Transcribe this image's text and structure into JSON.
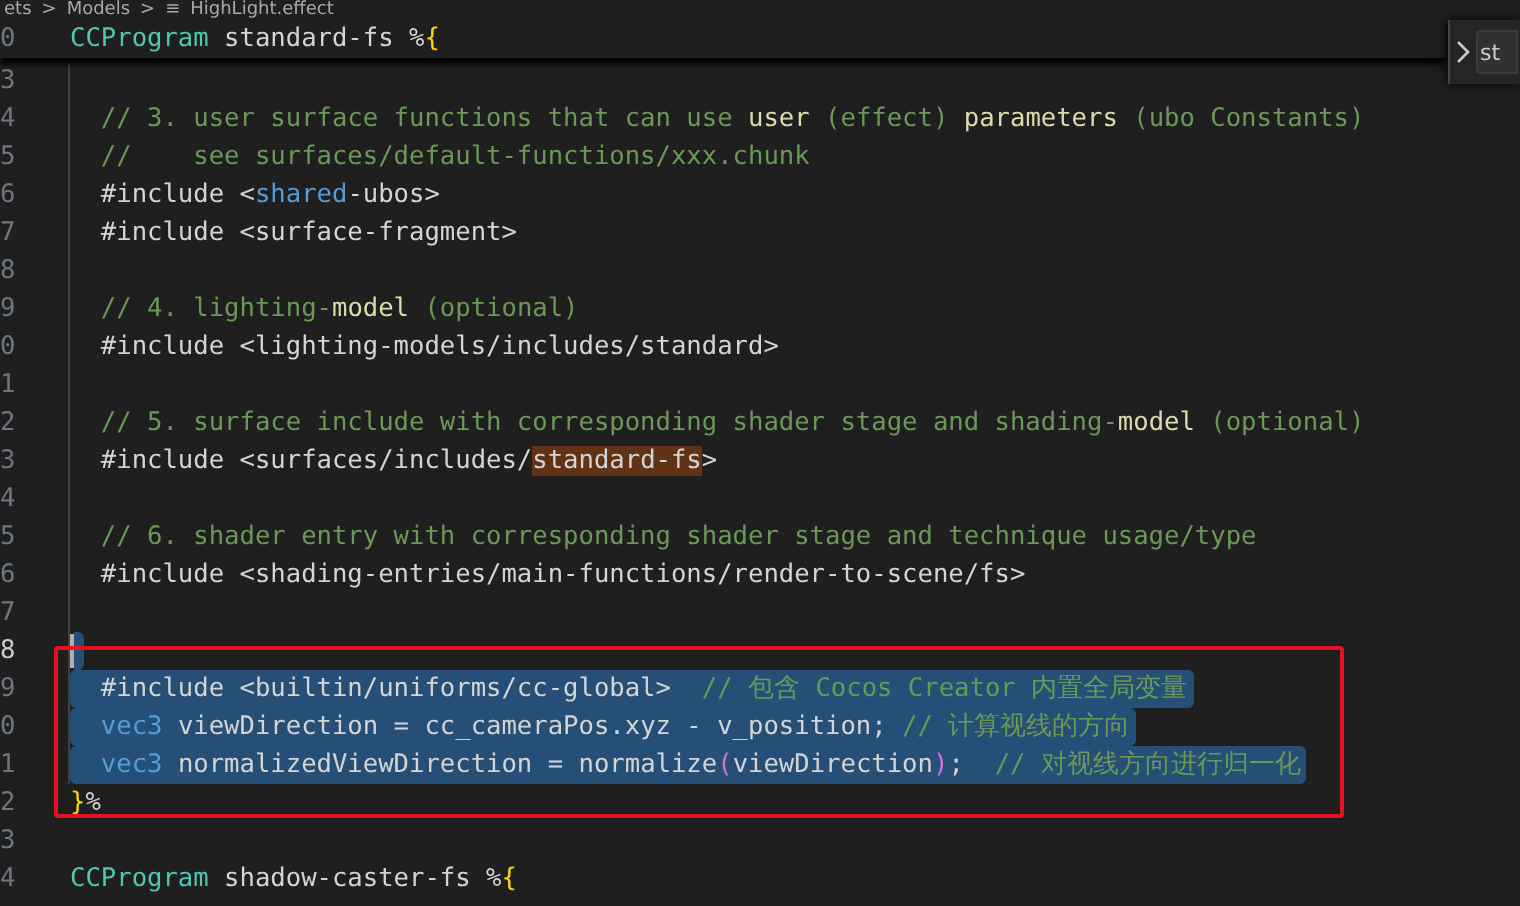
{
  "breadcrumb": {
    "items": [
      "ets",
      ">",
      "Models",
      ">",
      "≡",
      "HighLight.effect"
    ]
  },
  "sticky_line": {
    "number": "0",
    "segments": [
      {
        "kind": "type_name",
        "text": "CCProgram"
      },
      {
        "kind": "text",
        "text": " standard-fs %"
      },
      {
        "kind": "bracket",
        "text": "{"
      }
    ]
  },
  "find_widget": {
    "value": "st"
  },
  "lines": [
    {
      "number": "3",
      "current": false,
      "selected": false
    },
    {
      "number": "4",
      "current": false,
      "selected": false,
      "segments": [
        {
          "kind": "comment",
          "text": "  // 3. user surface functions that can use "
        },
        {
          "kind": "function",
          "text": "user"
        },
        {
          "kind": "comment",
          "text": " (effect) "
        },
        {
          "kind": "function",
          "text": "parameters"
        },
        {
          "kind": "comment",
          "text": " (ubo Constants)"
        }
      ]
    },
    {
      "number": "5",
      "current": false,
      "selected": false,
      "segments": [
        {
          "kind": "comment",
          "text": "  //    see surfaces/default-functions/xxx.chunk"
        }
      ]
    },
    {
      "number": "6",
      "current": false,
      "selected": false,
      "segments": [
        {
          "kind": "text",
          "text": "  #include <"
        },
        {
          "kind": "keyword",
          "text": "shared"
        },
        {
          "kind": "text",
          "text": "-ubos>"
        }
      ]
    },
    {
      "number": "7",
      "current": false,
      "selected": false,
      "segments": [
        {
          "kind": "text",
          "text": "  #include <surface-fragment>"
        }
      ]
    },
    {
      "number": "8",
      "current": false,
      "selected": false
    },
    {
      "number": "9",
      "current": false,
      "selected": false,
      "segments": [
        {
          "kind": "comment",
          "text": "  // 4. lighting-"
        },
        {
          "kind": "function",
          "text": "model"
        },
        {
          "kind": "comment",
          "text": " (optional)"
        }
      ]
    },
    {
      "number": "0",
      "current": false,
      "selected": false,
      "segments": [
        {
          "kind": "text",
          "text": "  #include <lighting-models/includes/standard>"
        }
      ]
    },
    {
      "number": "1",
      "current": false,
      "selected": false
    },
    {
      "number": "2",
      "current": false,
      "selected": false,
      "segments": [
        {
          "kind": "comment",
          "text": "  // 5. surface include with corresponding shader stage and shading-"
        },
        {
          "kind": "function",
          "text": "model"
        },
        {
          "kind": "comment",
          "text": " (optional)"
        }
      ]
    },
    {
      "number": "3",
      "current": false,
      "selected": false,
      "segments": [
        {
          "kind": "text",
          "text": "  #include <surfaces/includes/"
        },
        {
          "kind": "match",
          "text": "standard-fs"
        },
        {
          "kind": "text",
          "text": ">"
        }
      ]
    },
    {
      "number": "4",
      "current": false,
      "selected": false
    },
    {
      "number": "5",
      "current": false,
      "selected": false,
      "segments": [
        {
          "kind": "comment",
          "text": "  // 6. shader entry with corresponding shader stage and technique usage/type"
        }
      ]
    },
    {
      "number": "6",
      "current": false,
      "selected": false,
      "segments": [
        {
          "kind": "text",
          "text": "  #include <shading-entries/main-functions/render-to-scene/fs>"
        }
      ]
    },
    {
      "number": "7",
      "current": false,
      "selected": false
    },
    {
      "number": "8",
      "current": true,
      "selected": true
    },
    {
      "number": "9",
      "current": false,
      "selected": true,
      "segments": [
        {
          "kind": "text",
          "text": "  #include <builtin/uniforms/cc-global>  "
        },
        {
          "kind": "comment",
          "text": "// 包含 Cocos Creator 内置全局变量"
        }
      ]
    },
    {
      "number": "0",
      "current": false,
      "selected": true,
      "segments": [
        {
          "kind": "keyword",
          "text": "  vec3"
        },
        {
          "kind": "text",
          "text": " viewDirection = cc_cameraPos.xyz - v_position; "
        },
        {
          "kind": "comment",
          "text": "// 计算视线的方向"
        }
      ]
    },
    {
      "number": "1",
      "current": false,
      "selected": true,
      "segments": [
        {
          "kind": "keyword",
          "text": "  vec3"
        },
        {
          "kind": "text",
          "text": " normalizedViewDirection = normalize"
        },
        {
          "kind": "paren",
          "text": "("
        },
        {
          "kind": "text",
          "text": "viewDirection"
        },
        {
          "kind": "paren",
          "text": ")"
        },
        {
          "kind": "text",
          "text": ";  "
        },
        {
          "kind": "comment",
          "text": "// 对视线方向进行归一化"
        }
      ]
    },
    {
      "number": "2",
      "current": false,
      "selected": false,
      "segments": [
        {
          "kind": "bracket",
          "text": "}"
        },
        {
          "kind": "text",
          "text": "%"
        }
      ]
    },
    {
      "number": "3",
      "current": false,
      "selected": false
    },
    {
      "number": "4",
      "current": false,
      "selected": false,
      "segments": [
        {
          "kind": "type_name",
          "text": "CCProgram"
        },
        {
          "kind": "text",
          "text": " shadow-caster-fs %"
        },
        {
          "kind": "bracket",
          "text": "{"
        }
      ]
    }
  ]
}
